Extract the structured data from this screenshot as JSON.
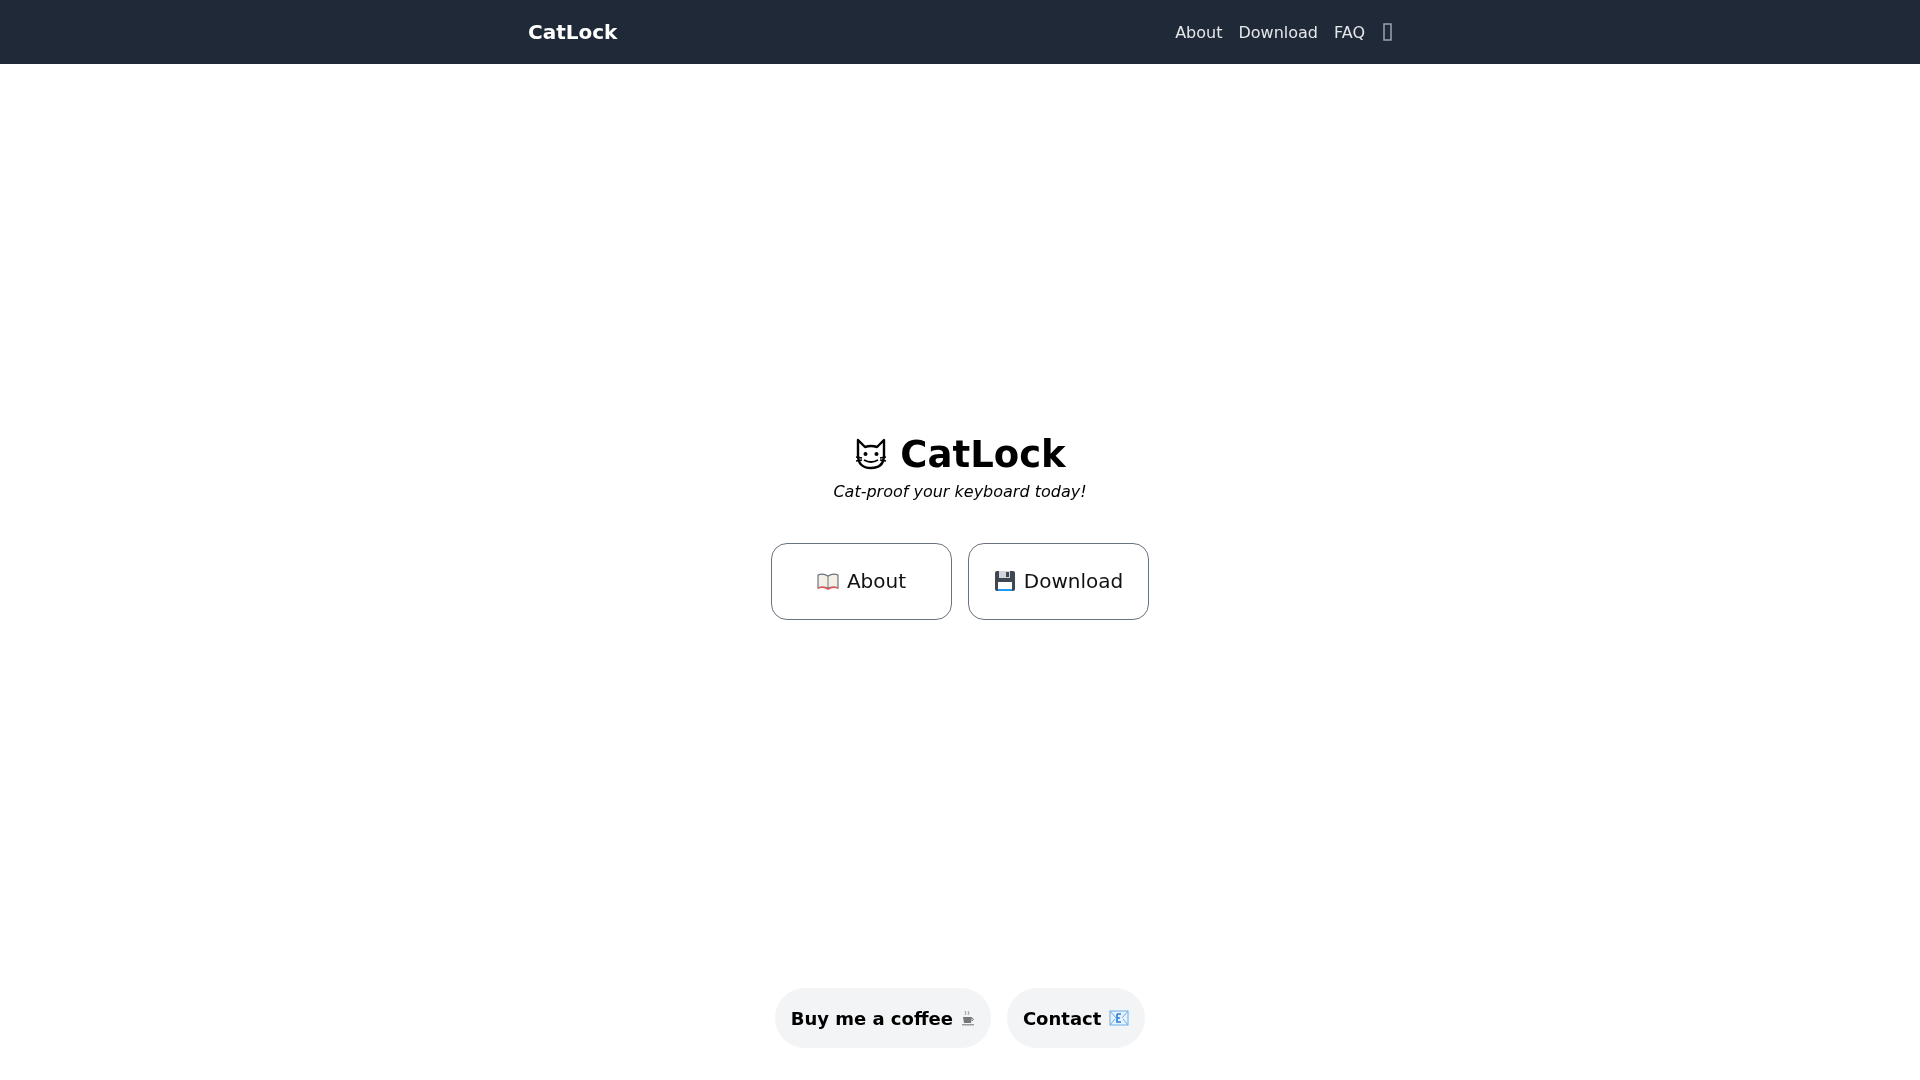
{
  "navbar": {
    "brand": "CatLock",
    "links": [
      {
        "label": "About"
      },
      {
        "label": "Download"
      },
      {
        "label": "FAQ"
      }
    ]
  },
  "hero": {
    "title": "CatLock",
    "tagline": "Cat-proof your keyboard today!",
    "buttons": [
      {
        "label": "About",
        "kind": "book"
      },
      {
        "label": "Download",
        "kind": "floppy"
      }
    ]
  },
  "footer": {
    "buttons": [
      {
        "label": "Buy me a coffee",
        "kind": "coffee"
      },
      {
        "label": "Contact",
        "kind": "mail"
      }
    ]
  }
}
